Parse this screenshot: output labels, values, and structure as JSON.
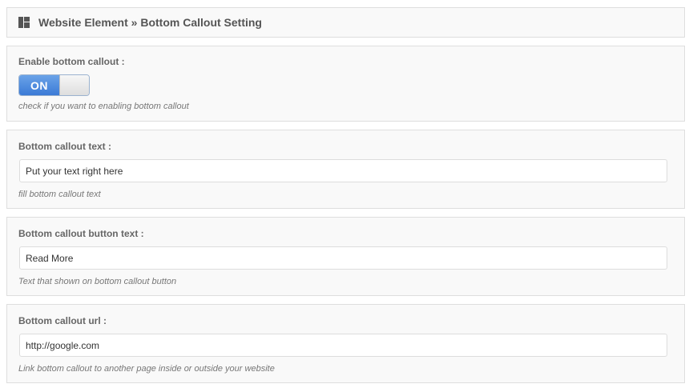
{
  "header": {
    "title": "Website Element » Bottom Callout Setting",
    "icon": "layout-icon"
  },
  "fields": {
    "enable": {
      "label": "Enable bottom callout :",
      "toggle_label": "ON",
      "toggle_state": "on",
      "help": "check if you want to enabling bottom callout"
    },
    "text": {
      "label": "Bottom callout text :",
      "value": "Put your text right here",
      "help": "fill bottom callout text"
    },
    "button_text": {
      "label": "Bottom callout button text :",
      "value": "Read More",
      "help": "Text that shown on bottom callout button"
    },
    "url": {
      "label": "Bottom callout url :",
      "value": "http://google.com",
      "help": "Link bottom callout to another page inside or outside your website"
    }
  },
  "colors": {
    "toggle_on": "#3b7ad6",
    "panel_bg": "#f9f9f9",
    "panel_border": "#dedede"
  }
}
